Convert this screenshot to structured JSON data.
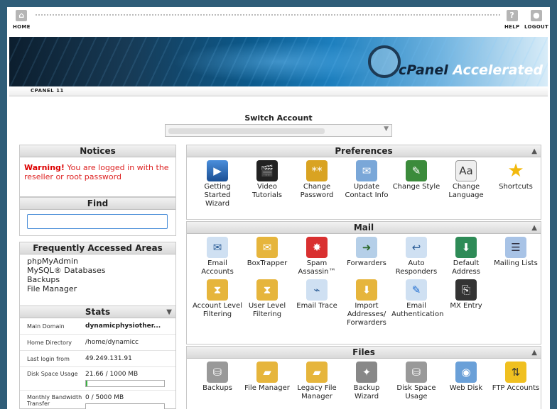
{
  "topnav": {
    "home": "HOME",
    "help": "HELP",
    "logout": "LOGOUT",
    "home_icon": "home-icon",
    "help_icon": "help-icon",
    "logout_icon": "logout-icon"
  },
  "banner": {
    "brand": "cPanel",
    "product": "Accelerated",
    "version": "2"
  },
  "version_label": "CPANEL 11",
  "switch_account": {
    "title": "Switch Account"
  },
  "notices": {
    "title": "Notices",
    "warning": "Warning!",
    "message": " You are logged in with the reseller or root password"
  },
  "find": {
    "title": "Find",
    "value": ""
  },
  "frequent": {
    "title": "Frequently Accessed Areas",
    "items": [
      "phpMyAdmin",
      "MySQL® Databases",
      "Backups",
      "File Manager"
    ]
  },
  "stats": {
    "title": "Stats",
    "rows": [
      {
        "label": "Main Domain",
        "value": "dynamicphysiother..."
      },
      {
        "label": "Home Directory",
        "value": "/home/dynamicc"
      },
      {
        "label": "Last login from",
        "value": "49.249.131.91"
      },
      {
        "label": "Disk Space Usage",
        "value": "21.66 / 1000 MB",
        "fraction": 0.022
      },
      {
        "label": "Monthly Bandwidth Transfer",
        "value": "0 / 5000 MB",
        "fraction": 0
      }
    ]
  },
  "preferences": {
    "title": "Preferences",
    "items": [
      {
        "label": "Getting Started Wizard",
        "icon": "play-icon"
      },
      {
        "label": "Video Tutorials",
        "icon": "film-icon"
      },
      {
        "label": "Change Password",
        "icon": "lock-icon"
      },
      {
        "label": "Update Contact Info",
        "icon": "contact-icon"
      },
      {
        "label": "Change Style",
        "icon": "style-icon"
      },
      {
        "label": "Change Language",
        "icon": "language-icon"
      },
      {
        "label": "Shortcuts",
        "icon": "star-icon"
      }
    ]
  },
  "mail": {
    "title": "Mail",
    "items": [
      {
        "label": "Email Accounts",
        "icon": "envelope-icon"
      },
      {
        "label": "BoxTrapper",
        "icon": "boxtrapper-icon"
      },
      {
        "label": "Spam Assassin™",
        "icon": "spamassassin-icon"
      },
      {
        "label": "Forwarders",
        "icon": "forwarders-icon"
      },
      {
        "label": "Auto Responders",
        "icon": "autoresponder-icon"
      },
      {
        "label": "Default Address",
        "icon": "default-address-icon"
      },
      {
        "label": "Mailing Lists",
        "icon": "mailing-list-icon"
      },
      {
        "label": "Account Level Filtering",
        "icon": "filter-icon"
      },
      {
        "label": "User Level Filtering",
        "icon": "user-filter-icon"
      },
      {
        "label": "Email Trace",
        "icon": "email-trace-icon"
      },
      {
        "label": "Import Addresses/ Forwarders",
        "icon": "import-icon"
      },
      {
        "label": "Email Authentication",
        "icon": "authentication-icon"
      },
      {
        "label": "MX Entry",
        "icon": "mx-entry-icon"
      }
    ]
  },
  "files": {
    "title": "Files",
    "items": [
      {
        "label": "Backups",
        "icon": "backup-icon"
      },
      {
        "label": "File Manager",
        "icon": "folder-icon"
      },
      {
        "label": "Legacy File Manager",
        "icon": "folder-icon"
      },
      {
        "label": "Backup Wizard",
        "icon": "wizard-icon"
      },
      {
        "label": "Disk Space Usage",
        "icon": "disk-icon"
      },
      {
        "label": "Web Disk",
        "icon": "web-disk-icon"
      },
      {
        "label": "FTP Accounts",
        "icon": "ftp-icon"
      }
    ]
  }
}
